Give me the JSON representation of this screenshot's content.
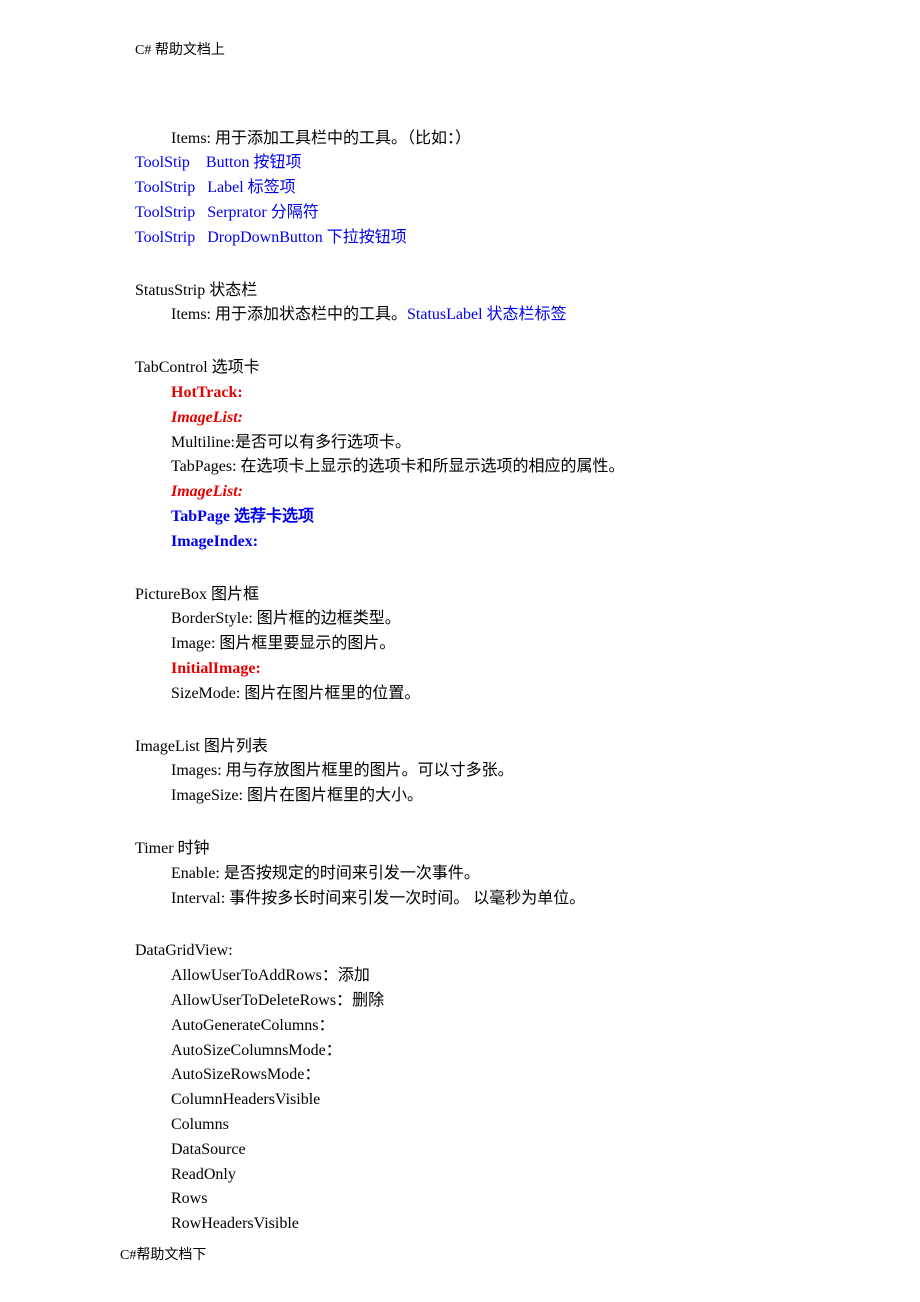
{
  "header": "C#  帮助文档上",
  "footer": "C#帮助文档下",
  "items_line": "Items:  用于添加工具栏中的工具。（比如：）",
  "tool_links": [
    "ToolStip    Button 按钮项",
    "ToolStrip   Label 标签项",
    "ToolStrip   Serprator 分隔符",
    "ToolStrip   DropDownButton 下拉按钮项"
  ],
  "statusstrip": {
    "title": "StatusStrip 状态栏",
    "items_prefix": "Items:  用于添加状态栏中的工具。",
    "items_link": "StatusLabel 状态栏标签"
  },
  "tabcontrol": {
    "title": "TabControl 选项卡",
    "hottrack": "HotTrack:",
    "imagelist1": "ImageList:",
    "multiline": "Multiline:是否可以有多行选项卡。",
    "tabpages": "TabPages:  在选项卡上显示的选项卡和所显示选项的相应的属性。",
    "imagelist2": "ImageList:",
    "tabpage": "TabPage 选荐卡选项",
    "imageindex": "ImageIndex:"
  },
  "picturebox": {
    "title": "PictureBox 图片框",
    "borderstyle": "BorderStyle:  图片框的边框类型。",
    "image": "Image:  图片框里要显示的图片。",
    "initialimage": "InitialImage:",
    "sizemode": "SizeMode:  图片在图片框里的位置。"
  },
  "imagelist": {
    "title": "ImageList  图片列表",
    "images": "Images:  用与存放图片框里的图片。可以寸多张。",
    "imagesize": "ImageSize:  图片在图片框里的大小。"
  },
  "timer": {
    "title": "Timer 时钟",
    "enable": "Enable:  是否按规定的时间来引发一次事件。",
    "interval": "Interval:  事件按多长时间来引发一次时间。    以毫秒为单位。"
  },
  "dgv": {
    "title": "DataGridView:",
    "props": [
      "AllowUserToAddRows：添加",
      "AllowUserToDeleteRows：删除",
      "AutoGenerateColumns：",
      "AutoSizeColumnsMode：",
      "AutoSizeRowsMode：",
      "ColumnHeadersVisible",
      "Columns",
      "DataSource",
      "ReadOnly",
      "Rows",
      "RowHeadersVisible"
    ]
  }
}
